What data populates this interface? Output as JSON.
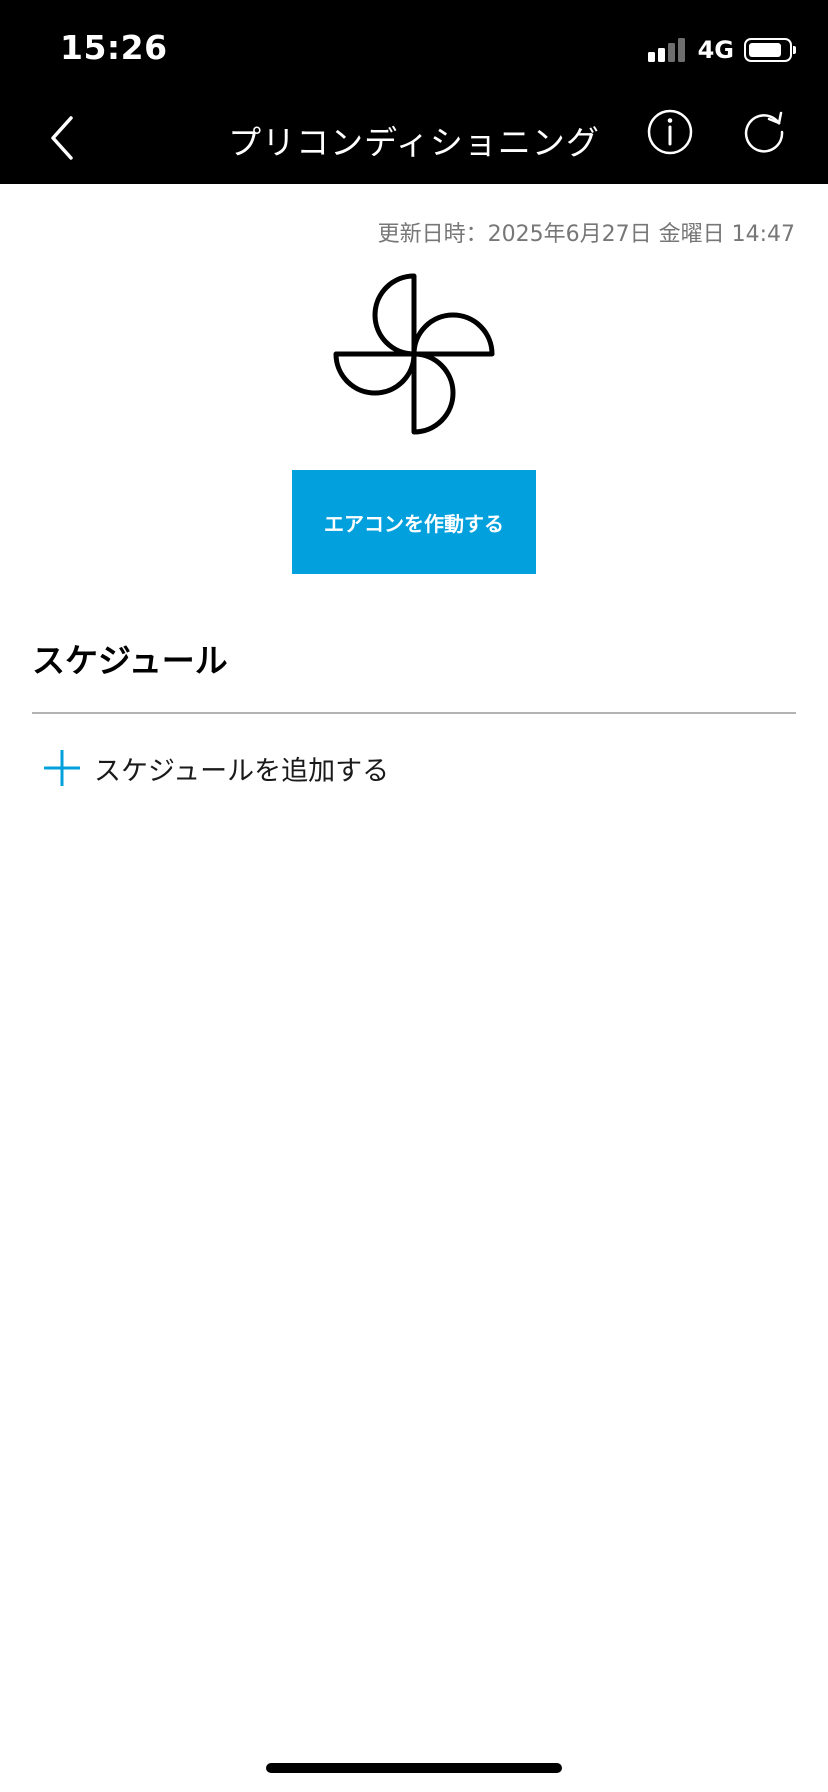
{
  "status_bar": {
    "time": "15:26",
    "network": "4G",
    "signal_bars_active": 2,
    "signal_bars_total": 4,
    "battery_level": 0.85
  },
  "nav": {
    "title": "プリコンディショニング",
    "back_icon": "chevron-left-icon",
    "info_icon": "info-icon",
    "refresh_icon": "refresh-icon"
  },
  "main": {
    "updated_label": "更新日時：2025年6月27日 金曜日 14:47",
    "fan_icon": "fan-icon",
    "ac_button_label": "エアコンを作動する"
  },
  "schedule": {
    "title": "スケジュール",
    "add_label": "スケジュールを追加する",
    "add_icon": "plus-icon"
  },
  "colors": {
    "header_background": "#000000",
    "accent": "#03A0DE",
    "divider": "#b3b3b3",
    "updated_text": "#777777"
  }
}
